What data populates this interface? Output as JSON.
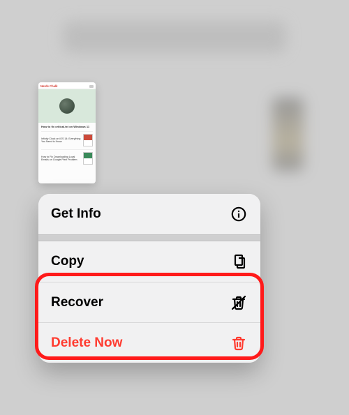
{
  "thumbnail": {
    "brand": "Nerds Chalk",
    "headline": "How to fix critical.txt on Windows 11",
    "rows": [
      {
        "snippet": "Infinity Clock on iOS 14: Everything You Need to Know"
      },
      {
        "snippet": "How to Fix Downloading Local Emails on Google Pixel Problem"
      }
    ]
  },
  "menu": {
    "getInfo": "Get Info",
    "copy": "Copy",
    "recover": "Recover",
    "deleteNow": "Delete Now"
  },
  "colors": {
    "destructive": "#ff3b30",
    "highlight": "#ff1a1a"
  }
}
